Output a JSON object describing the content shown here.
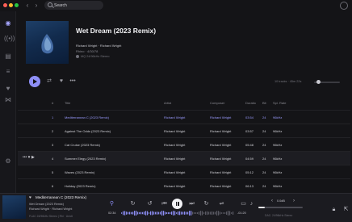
{
  "colors": {
    "accent": "#8e8ff7",
    "background": "#141417",
    "playing_text": "#9a9bff"
  },
  "search": {
    "placeholder": "Search"
  },
  "sidebar": {
    "icons": [
      "home-icon",
      "radio-icon",
      "library-icon",
      "playlist-icon",
      "heart-icon",
      "network-icon",
      "settings-icon"
    ]
  },
  "album": {
    "title": "Wet Dream  (2023 Remix)",
    "artist": "Richard Wright · Richard Wright",
    "meta": "Rhino  ·  4/30/78",
    "format": "MQ  24/96kHz Stereo"
  },
  "toolbar": {
    "tracks_info": "10 tracks · 45m 22s"
  },
  "table": {
    "headers": {
      "num": "#",
      "title": "Title",
      "artist": "Artist",
      "composer": "Composer",
      "duration": "Duratio",
      "bits": "Bit",
      "rate": "Spl. Rate"
    },
    "rows": [
      {
        "num": "1",
        "title": "Mediterranean C  (2023 Remix)",
        "artist": "Richard Wright",
        "composer": "Richard Wright",
        "duration": "03:54",
        "bits": "24",
        "rate": "96kHz"
      },
      {
        "num": "2",
        "title": "Against The Odds  (2023 Remix)",
        "artist": "Richard Wright",
        "composer": "Richard Wright",
        "duration": "03:57",
        "bits": "24",
        "rate": "96kHz"
      },
      {
        "num": "3",
        "title": "Cat Cruise  (2023 Remix)",
        "artist": "Richard Wright",
        "composer": "Richard Wright",
        "duration": "05:48",
        "bits": "24",
        "rate": "96kHz"
      },
      {
        "num": "4",
        "title": "Summer Elegy  (2023 Remix)",
        "artist": "Richard Wright",
        "composer": "Richard Wright",
        "duration": "04:59",
        "bits": "24",
        "rate": "96kHz"
      },
      {
        "num": "5",
        "title": "Waves  (2023 Remix)",
        "artist": "Richard Wright",
        "composer": "Richard Wright",
        "duration": "05:12",
        "bits": "24",
        "rate": "96kHz"
      },
      {
        "num": "6",
        "title": "Holiday  (2023 Remix)",
        "artist": "Richard Wright",
        "composer": "Richard Wright",
        "duration": "06:13",
        "bits": "24",
        "rate": "96kHz"
      }
    ]
  },
  "player": {
    "title": "Mediterranean C  (2023 Remix)",
    "album": "Wet Dream  (2023 Remix)",
    "artist": "Richard Wright · Richard Wright",
    "format": "FLAC 24/96kHz Stereo | Rhi · Unidt",
    "elapsed": "02:34",
    "remaining": "-01:20",
    "gain": "0.0dB",
    "volume_fraction": 0.15,
    "output": "DAC: 24/96kHz Stereo"
  }
}
